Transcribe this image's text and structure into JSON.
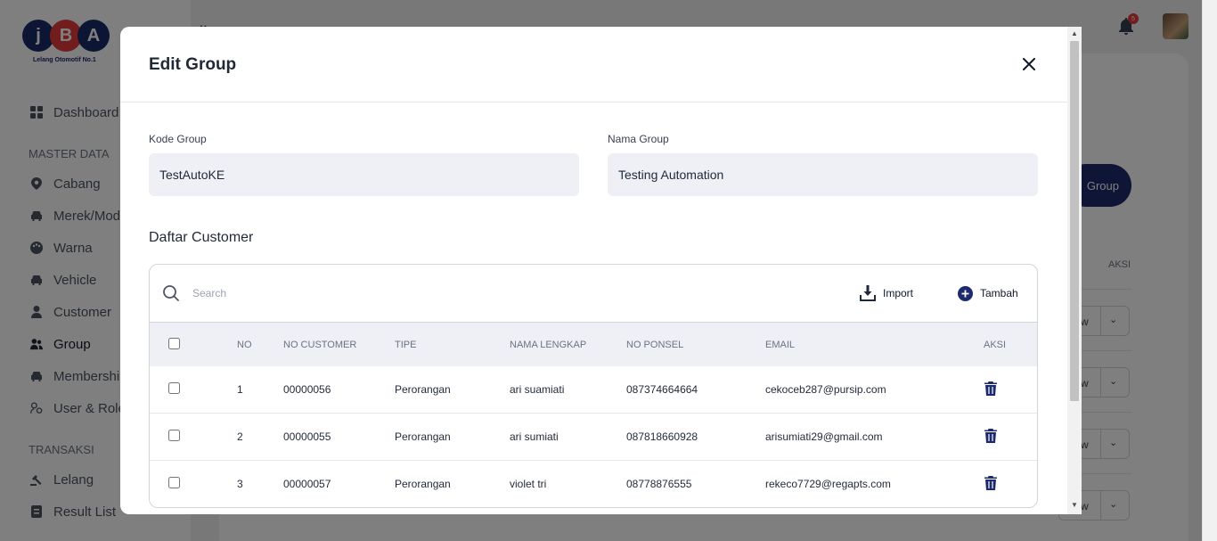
{
  "app": {
    "logo_letters": [
      "j",
      "B",
      "A"
    ],
    "logo_tagline": "Lelang Otomotif No.1",
    "notification_count": "5"
  },
  "sidebar": {
    "top_item": {
      "label": "Dashboard",
      "icon": "dashboard-icon"
    },
    "master_data_title": "MASTER DATA",
    "master_items": [
      {
        "label": "Cabang",
        "icon": "location-pin-icon"
      },
      {
        "label": "Merek/Model",
        "icon": "car-icon"
      },
      {
        "label": "Warna",
        "icon": "palette-icon"
      },
      {
        "label": "Vehicle",
        "icon": "car-icon"
      },
      {
        "label": "Customer",
        "icon": "user-icon"
      },
      {
        "label": "Group",
        "icon": "users-icon",
        "active": true
      },
      {
        "label": "Membership",
        "icon": "car-icon"
      },
      {
        "label": "User & Role",
        "icon": "user-cog-icon"
      }
    ],
    "transaksi_title": "TRANSAKSI",
    "transaksi_items": [
      {
        "label": "Lelang",
        "icon": "gavel-icon"
      },
      {
        "label": "Result List",
        "icon": "list-icon"
      }
    ]
  },
  "background": {
    "add_group_button": "Group",
    "aksi_header": "AKSI",
    "row_action_label": "w"
  },
  "modal": {
    "title": "Edit Group",
    "close_icon": "close-icon",
    "kode_group_label": "Kode Group",
    "kode_group_value": "TestAutoKE",
    "nama_group_label": "Nama Group",
    "nama_group_value": "Testing Automation",
    "daftar_customer_title": "Daftar Customer",
    "search_placeholder": "Search",
    "import_label": "Import",
    "tambah_label": "Tambah",
    "columns": [
      "NO",
      "NO CUSTOMER",
      "TIPE",
      "NAMA LENGKAP",
      "NO PONSEL",
      "EMAIL",
      "AKSI"
    ],
    "rows": [
      {
        "no": "1",
        "no_customer": "00000056",
        "tipe": "Perorangan",
        "nama": "ari suamiati",
        "ponsel": "087374664664",
        "email": "cekoceb287@pursip.com"
      },
      {
        "no": "2",
        "no_customer": "00000055",
        "tipe": "Perorangan",
        "nama": "ari sumiati",
        "ponsel": "087818660928",
        "email": "arisumiati29@gmail.com"
      },
      {
        "no": "3",
        "no_customer": "00000057",
        "tipe": "Perorangan",
        "nama": "violet tri",
        "ponsel": "08778876555",
        "email": "rekeco7729@regapts.com"
      }
    ]
  },
  "colors": {
    "brand_navy": "#1e2a6e",
    "brand_red": "#e23a3a",
    "input_bg": "#eef0f6"
  }
}
